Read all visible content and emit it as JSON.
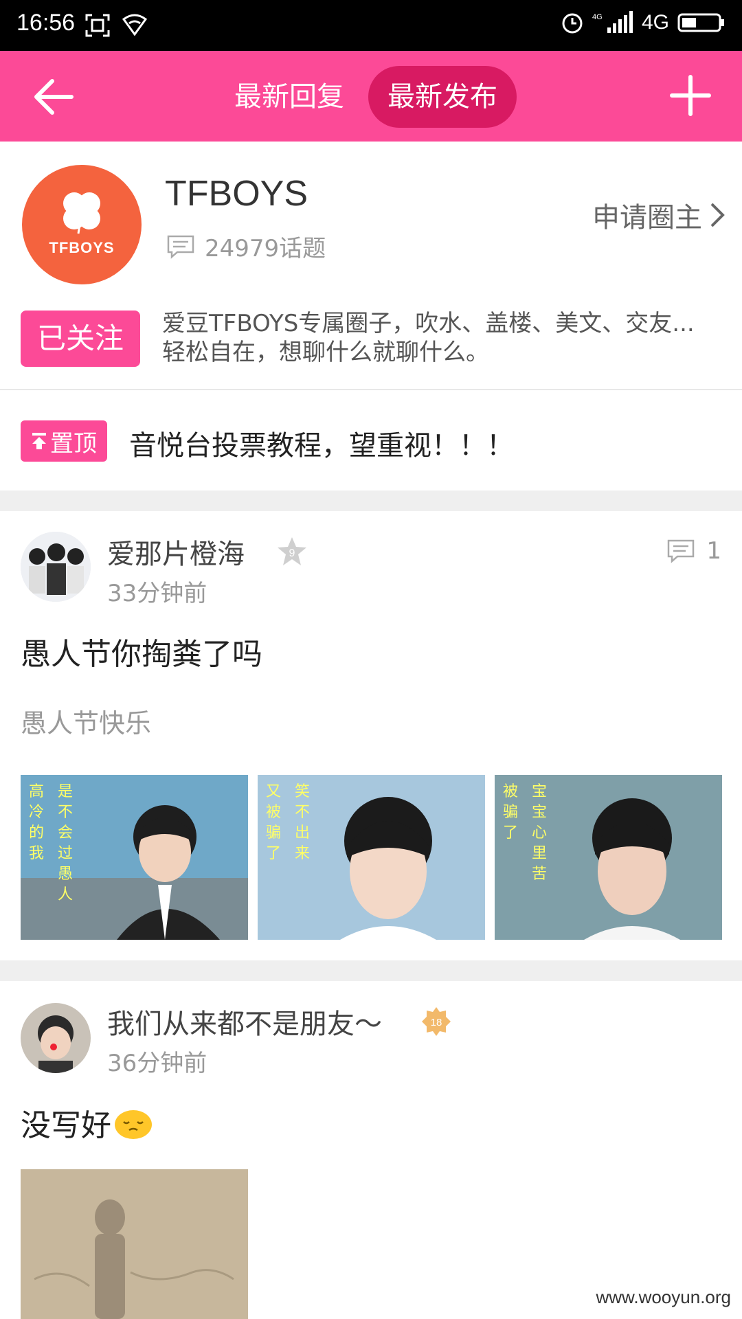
{
  "status_bar": {
    "time": "16:56",
    "network": "4G"
  },
  "nav": {
    "tab_reply": "最新回复",
    "tab_publish": "最新发布",
    "selected_tab": "最新发布"
  },
  "circle": {
    "logo_text": "TFBOYS",
    "name": "TFBOYS",
    "topic_count": "24979话题",
    "apply_owner": "申请圈主",
    "follow_label": "已关注",
    "desc_line1": "爱豆TFBOYS专属圈子，吹水、盖楼、美文、交友...",
    "desc_line2": "轻松自在，想聊什么就聊什么。"
  },
  "pinned": {
    "badge": "置顶",
    "title": "音悦台投票教程，望重视！！！"
  },
  "posts": [
    {
      "author": "爱那片橙海",
      "level": "9",
      "time": "33分钟前",
      "comments": "1",
      "title": "愚人节你掏粪了吗",
      "subtitle": "愚人节快乐",
      "images": [
        {
          "caption_cols": [
            "高冷的我",
            "是不会过愚人"
          ]
        },
        {
          "caption_cols": [
            "又被骗了",
            "笑不出来"
          ]
        },
        {
          "caption_cols": [
            "被骗了",
            "宝宝心里苦"
          ]
        }
      ]
    },
    {
      "author": "我们从来都不是朋友～",
      "level": "18",
      "time": "36分钟前",
      "title": "没写好"
    }
  ],
  "watermark": "www.wooyun.org",
  "colors": {
    "brand_pink": "#fc4a97",
    "tab_active": "#d81a62",
    "logo_orange": "#f4633e"
  }
}
